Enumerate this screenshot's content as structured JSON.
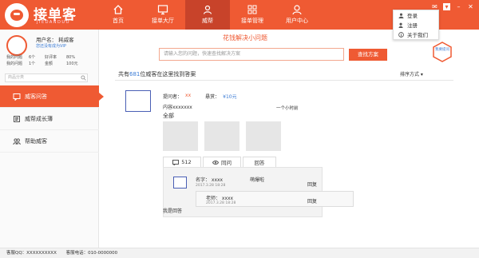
{
  "app": {
    "logo_title": "接单客",
    "logo_sub": "JIEDANDUO"
  },
  "nav": [
    {
      "label": "首页",
      "icon": "home-icon"
    },
    {
      "label": "接单大厅",
      "icon": "monitor-icon"
    },
    {
      "label": "威帮",
      "icon": "team-icon"
    },
    {
      "label": "接单管理",
      "icon": "grid-icon"
    },
    {
      "label": "用户中心",
      "icon": "user-icon"
    }
  ],
  "menu": {
    "items": [
      "登录",
      "注册",
      "关于我们"
    ]
  },
  "user": {
    "name_label": "用户名：",
    "name_value": "耗威客",
    "vip_text": "您还没有成为VIP",
    "stats": [
      {
        "k1": "我的问题",
        "v1": "6个",
        "k2": "好评率",
        "v2": "80%"
      },
      {
        "k1": "我的问题",
        "v1": "1个",
        "k2": "金额",
        "v2": "100元"
      }
    ],
    "search_placeholder": "商品分类"
  },
  "sidebar": {
    "items": [
      {
        "label": "威客问答",
        "icon": "qa-icon"
      },
      {
        "label": "威帮成长薄",
        "icon": "book-icon"
      },
      {
        "label": "帮助威客",
        "icon": "help-users-icon"
      }
    ]
  },
  "main": {
    "banner_title": "花钱解决小问题",
    "search_placeholder": "请输入您的问题，快速查找解决方案",
    "search_button": "查找方案",
    "hex_button": "我要提问",
    "count_prefix": "共有",
    "count_num": "681",
    "count_suffix": "位威客在这里找到答案",
    "sort_label": "排序方式 ▾"
  },
  "question": {
    "asker_label": "提问者：",
    "asker_value": "xx",
    "reward_label": "悬赏：",
    "reward_value": "¥10元",
    "content": "内容xxxxxxx",
    "time": "一个小时前",
    "all": "全部"
  },
  "tabs": [
    {
      "label": "512",
      "icon": "comment-icon"
    },
    {
      "label": "同问",
      "icon": "eye-icon"
    },
    {
      "label": "回答",
      "icon": ""
    }
  ],
  "reply": {
    "name": "名字：  xxxx",
    "name2": "萌爆啦",
    "date": "2017.3.28   18:28",
    "reply_label": "回复",
    "sub_name": "老师：  xxxx",
    "sub_date": "2017.3.28   18:28",
    "sub_reply": "回复",
    "my_answer": "我是回答"
  },
  "status": {
    "qq": "客服QQ：XXXXXXXXXX",
    "phone": "客服电话：010-0000000"
  },
  "colors": {
    "brand": "#ef5a33",
    "link": "#3a7bd5"
  }
}
